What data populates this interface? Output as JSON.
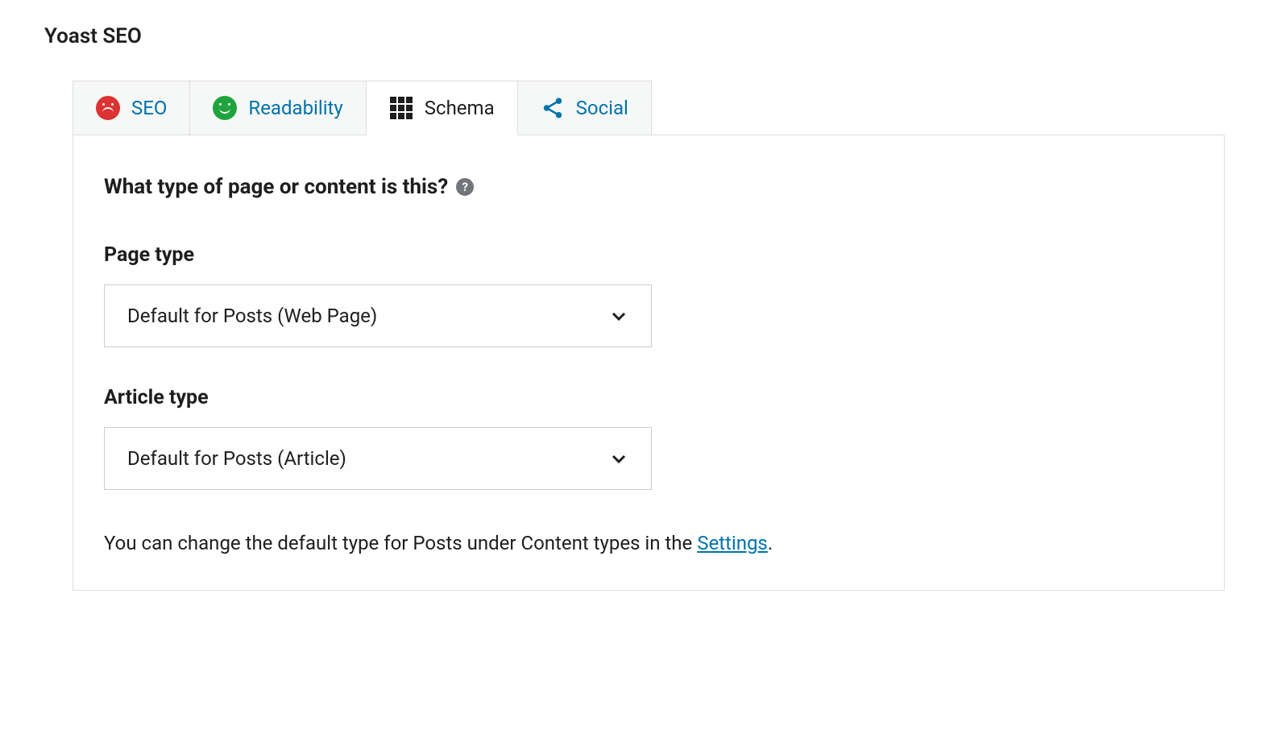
{
  "panel": {
    "title": "Yoast SEO"
  },
  "tabs": {
    "seo": "SEO",
    "readability": "Readability",
    "schema": "Schema",
    "social": "Social"
  },
  "schema": {
    "heading": "What type of page or content is this?",
    "page_type": {
      "label": "Page type",
      "selected": "Default for Posts (Web Page)"
    },
    "article_type": {
      "label": "Article type",
      "selected": "Default for Posts (Article)"
    },
    "note_prefix": "You can change the default type for Posts under Content types in the ",
    "note_link": "Settings",
    "note_suffix": "."
  }
}
